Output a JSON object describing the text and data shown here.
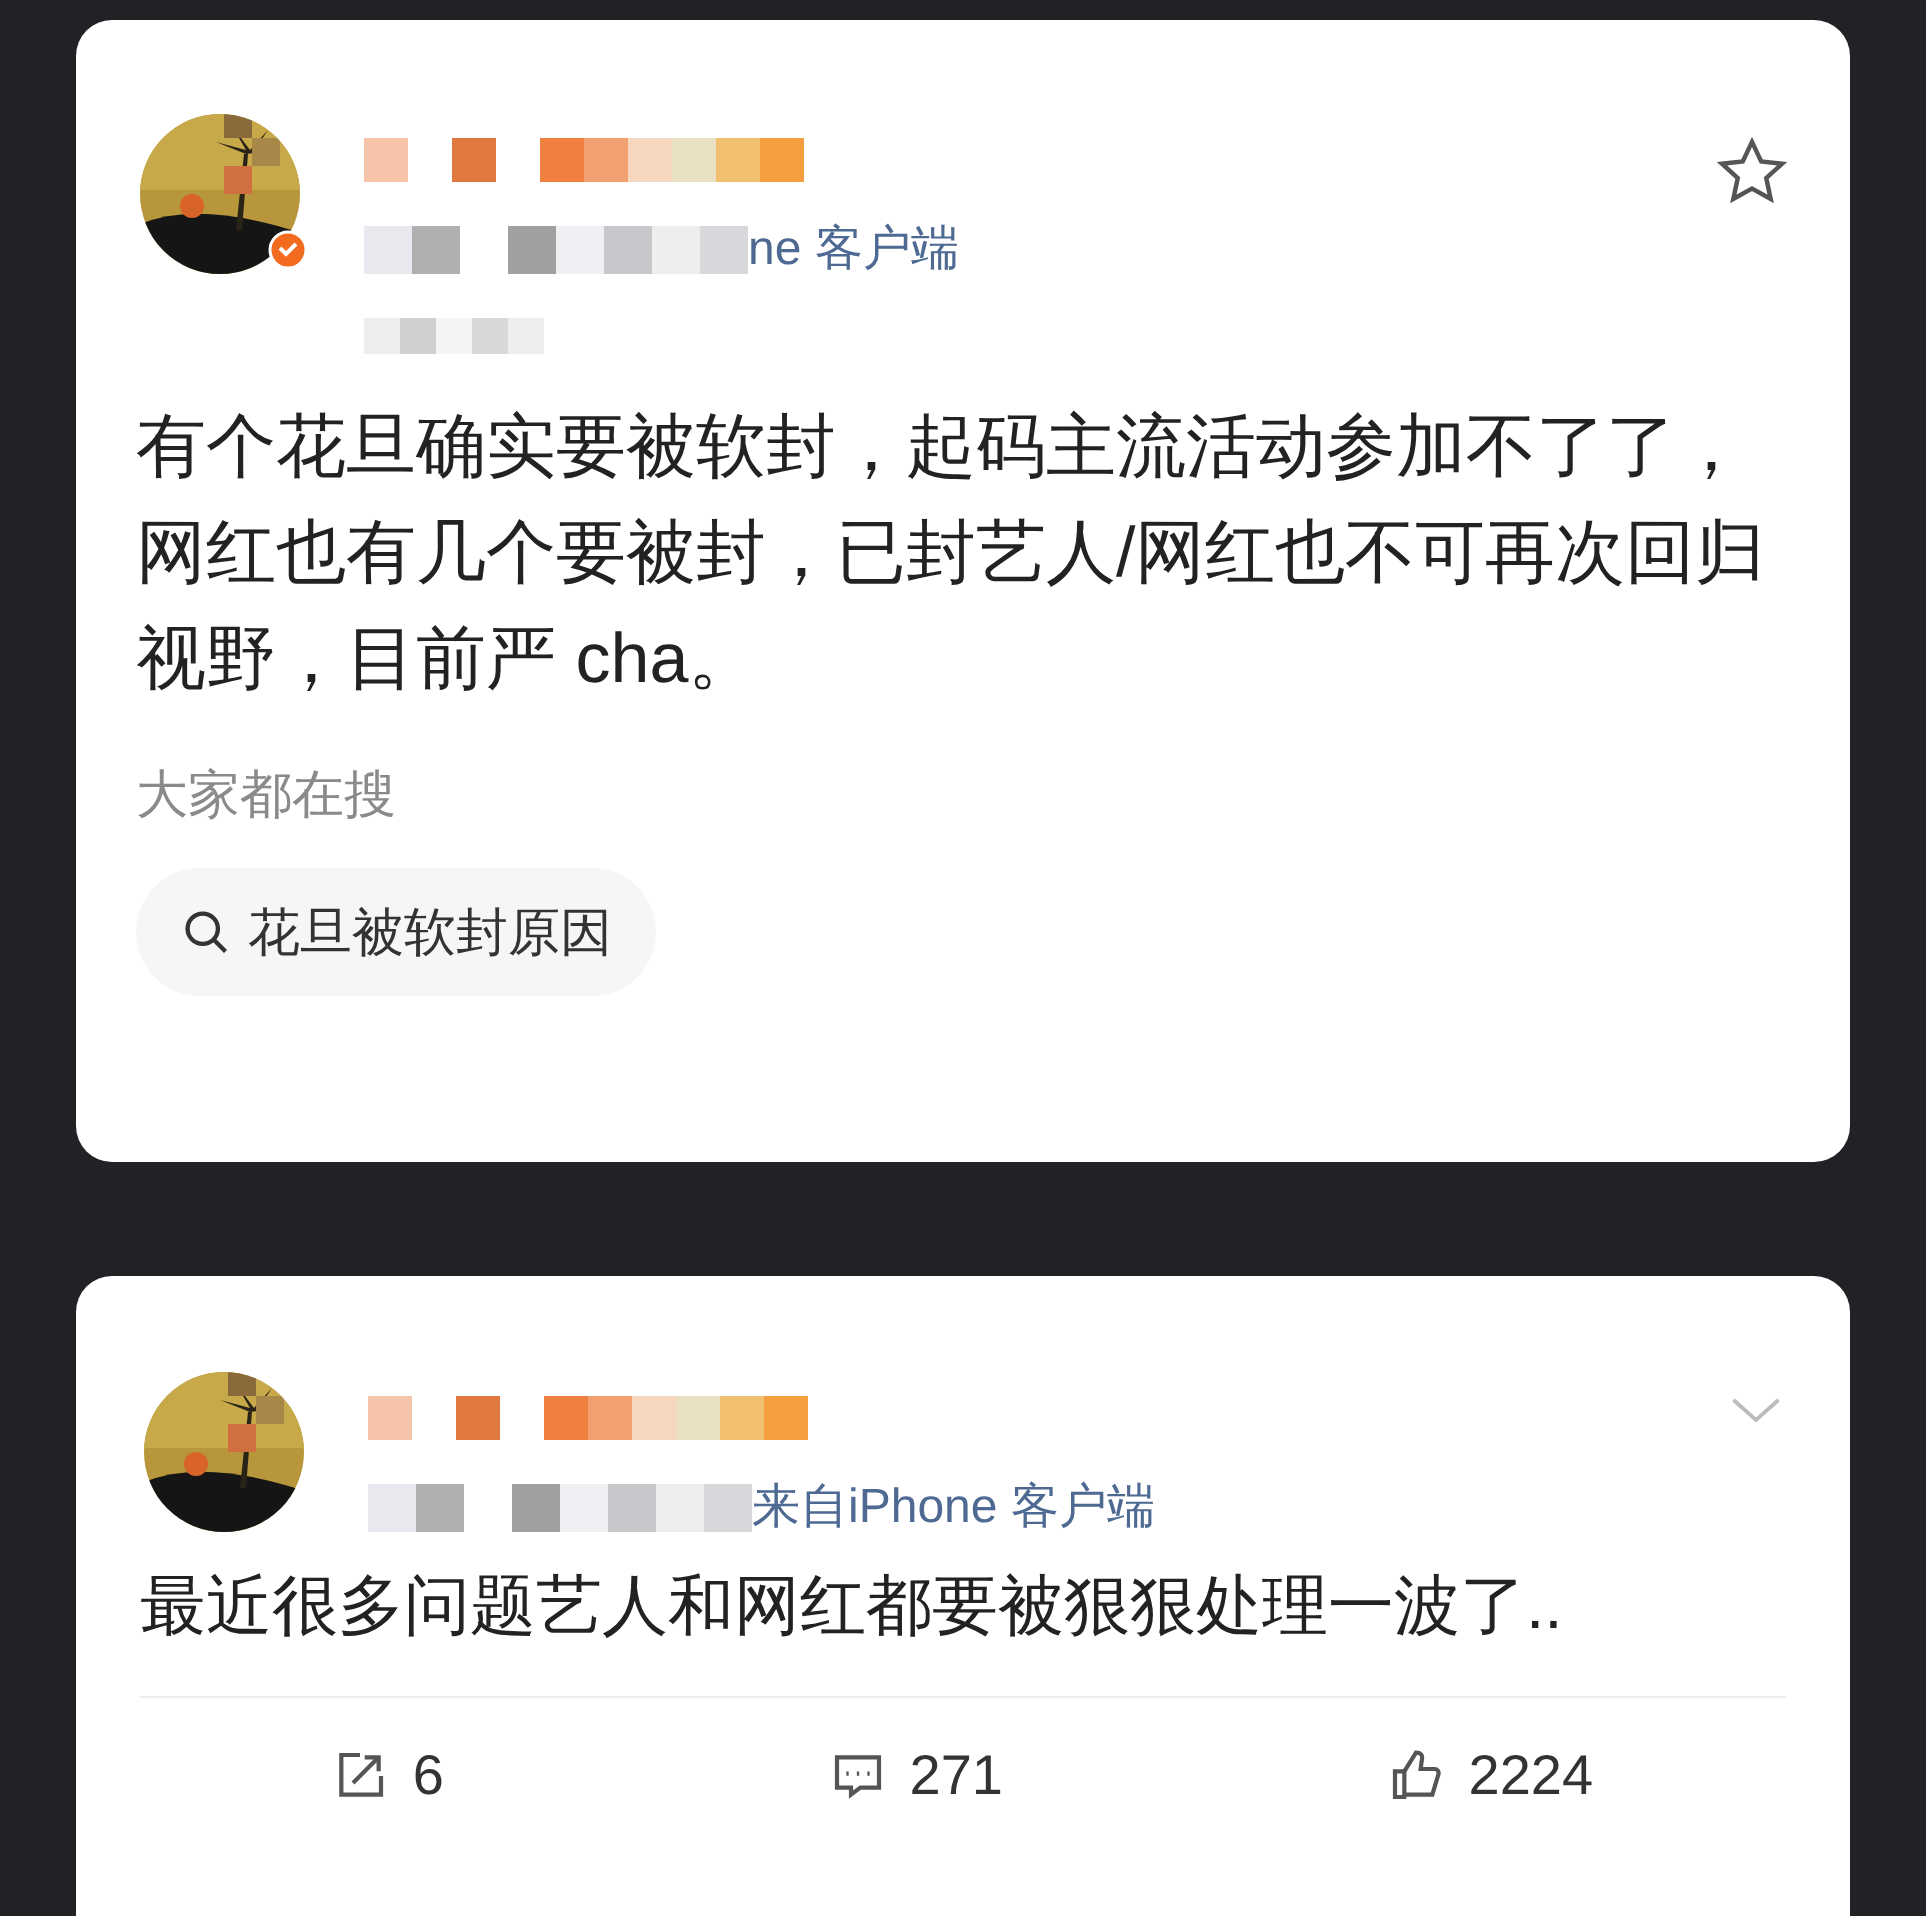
{
  "posts": [
    {
      "kind": "full",
      "verified": true,
      "source": "ne 客户端",
      "body_lines": [
        "有个花旦确实要被软封，起码主流活动参加不了了，",
        "网红也有几个要被封，已封艺人/网红也不可再次回归",
        "视野，目前严 cha。"
      ],
      "search_heading": "大家都在搜",
      "search_chip": "花旦被软封原因"
    },
    {
      "kind": "compact",
      "verified": false,
      "source": "来自iPhone 客户端",
      "body_lines": [
        "最近很多问题艺人和网红都要被狠狠处理一波了.."
      ],
      "actions": [
        {
          "kind": "repost",
          "count": "6"
        },
        {
          "kind": "comment",
          "count": "271"
        },
        {
          "kind": "like",
          "count": "2224"
        }
      ]
    }
  ]
}
